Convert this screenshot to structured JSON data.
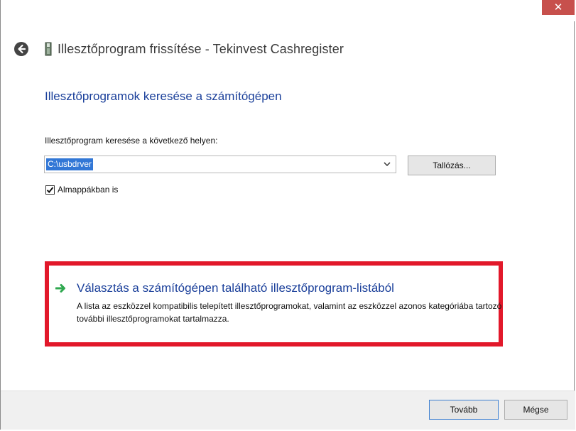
{
  "window": {
    "close_glyph": "✕",
    "title": "Illesztőprogram frissítése - Tekinvest Cashregister",
    "icon": "usb-device-icon"
  },
  "main": {
    "heading": "Illesztőprogramok keresése a számítógépen",
    "location_label": "Illesztőprogram keresése a következő helyen:",
    "location_value": "C:\\usbdrver",
    "browse_label": "Tallózás...",
    "subfolders_label": "Almappákban is",
    "subfolders_checked": true
  },
  "option": {
    "title": "Választás a számítógépen található illesztőprogram-listából",
    "description": "A lista az eszközzel kompatibilis telepített illesztőprogramokat, valamint az eszközzel azonos kategóriába tartozó további illesztőprogramokat tartalmazza.",
    "arrow_color": "#2fa84f",
    "highlight_color": "#e2182a"
  },
  "footer": {
    "next_label": "Tovább",
    "cancel_label": "Mégse"
  }
}
